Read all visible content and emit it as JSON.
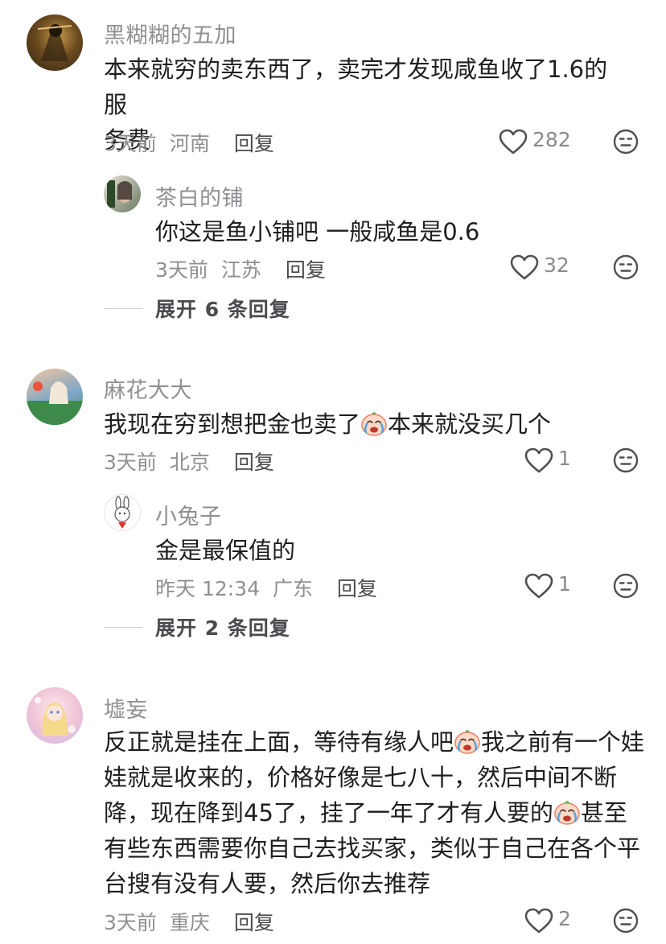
{
  "comments": [
    {
      "username": "黑糊糊的五加",
      "text": "本来就穷的卖东西了，卖完才发现咸鱼收了1.6的服务费",
      "time": "3天前",
      "location": "河南",
      "reply_label": "回复",
      "likes": "282",
      "replies": [
        {
          "username": "茶白的铺",
          "text": "你这是鱼小铺吧 一般咸鱼是0.6",
          "time": "3天前",
          "location": "江苏",
          "reply_label": "回复",
          "likes": "32"
        }
      ],
      "expand_label": "展开 6 条回复"
    },
    {
      "username": "麻花大大",
      "text_a": "我现在穷到想把金也卖了",
      "text_b": "本来就没买几个",
      "time": "3天前",
      "location": "北京",
      "reply_label": "回复",
      "likes": "1",
      "replies": [
        {
          "username": "小兔子",
          "text": "金是最保值的",
          "time": "昨天 12:34",
          "location": "广东",
          "reply_label": "回复",
          "likes": "1"
        }
      ],
      "expand_label": "展开 2 条回复"
    },
    {
      "username": "墟妄",
      "line1_a": "反正就是挂在上面，等待有缘人吧",
      "line1_b": "我之前有一个娃",
      "line2": "娃就是收来的，价格好像是七八十，然后中间不断",
      "line3_a": "降，现在降到45了，挂了一年了才有人要的",
      "line3_b": "甚至",
      "line4": "有些东西需要你自己去找买家，类似于自己在各个平",
      "line5": "台搜有没有人要，然后你去推荐",
      "time": "3天前",
      "location": "重庆",
      "reply_label": "回复",
      "likes": "2"
    }
  ],
  "icons": {
    "like": "heart-outline-icon",
    "dislike": "neutral-face-icon",
    "emoji": "crying-face-emoji"
  },
  "colors": {
    "meta": "#8f8f94",
    "text": "#1e1e1e",
    "reply": "#4a4a4f"
  }
}
